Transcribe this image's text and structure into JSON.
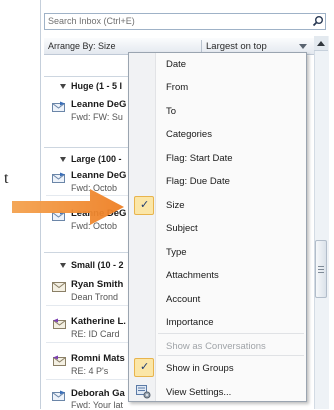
{
  "side_text": "t",
  "search": {
    "placeholder": "Search Inbox (Ctrl+E)"
  },
  "arrange": {
    "label": "Arrange By: Size",
    "order": "Largest on top"
  },
  "groups": [
    {
      "label": "Huge (1 - 5 I"
    },
    {
      "label": "Large (100 -"
    },
    {
      "label": "Small (10 - 2"
    }
  ],
  "messages": [
    {
      "sender": "Leanne DeG",
      "subject": "Fwd: FW: Su"
    },
    {
      "sender": "Leanne DeG",
      "subject": "Fwd: Octob"
    },
    {
      "sender": "Leanne DeG",
      "subject": "Fwd: Octob"
    },
    {
      "sender": "Ryan Smith",
      "subject": "Dean Trond"
    },
    {
      "sender": "Katherine L.",
      "subject": "RE: ID Card"
    },
    {
      "sender": "Romni Mats",
      "subject": "RE: 4 P's"
    },
    {
      "sender": "Deborah Ga",
      "subject": "Fwd: Your lat"
    }
  ],
  "menu": {
    "items": [
      {
        "label": "Date",
        "checked": false
      },
      {
        "label": "From",
        "checked": false
      },
      {
        "label": "To",
        "checked": false
      },
      {
        "label": "Categories",
        "checked": false
      },
      {
        "label": "Flag: Start Date",
        "checked": false
      },
      {
        "label": "Flag: Due Date",
        "checked": false
      },
      {
        "label": "Size",
        "checked": true
      },
      {
        "label": "Subject",
        "checked": false
      },
      {
        "label": "Type",
        "checked": false
      },
      {
        "label": "Attachments",
        "checked": false
      },
      {
        "label": "Account",
        "checked": false
      },
      {
        "label": "Importance",
        "checked": false
      }
    ],
    "show_as_conversations": "Show as Conversations",
    "show_in_groups": "Show in Groups",
    "view_settings": "View Settings..."
  },
  "colors": {
    "arrow": "#f08a2c",
    "check_highlight": "#fbe6a7",
    "menu_border": "#9aa4b0"
  }
}
